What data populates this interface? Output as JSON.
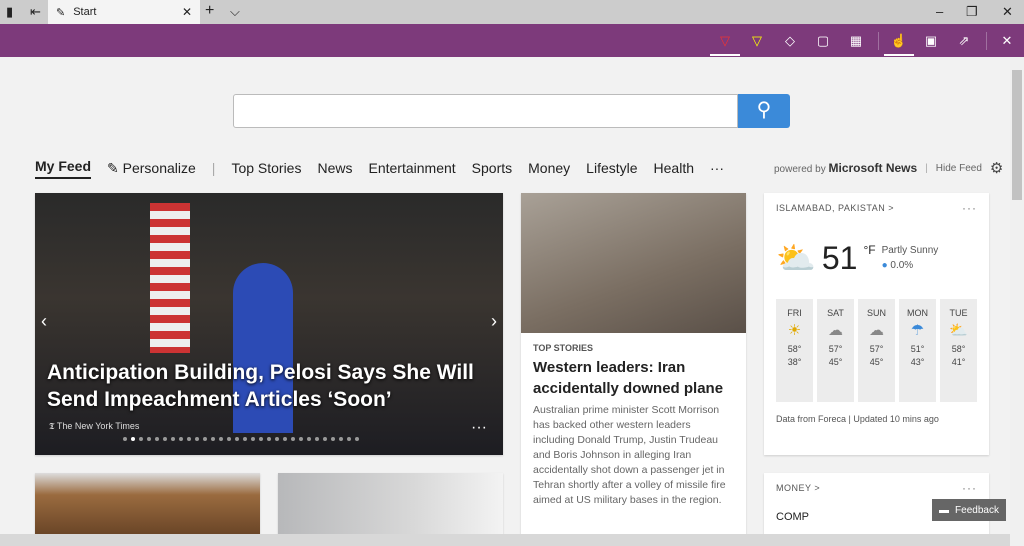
{
  "browser": {
    "tab_title": "Start",
    "new_tab": "+",
    "tab_list": "⌵",
    "minimize": "–",
    "restore": "❐",
    "close": "✕",
    "tab_close": "✕"
  },
  "ink_toolbar": {
    "icons": [
      "ballpoint-pen-icon",
      "highlighter-icon",
      "eraser-icon",
      "add-note-icon",
      "clip-icon",
      "touch-writing-icon",
      "save-icon",
      "share-icon",
      "close-icon"
    ],
    "accent": "#7d3a7b"
  },
  "search": {
    "placeholder": "",
    "button": "⚲"
  },
  "nav": {
    "items": [
      "My Feed",
      "Personalize",
      "Top Stories",
      "News",
      "Entertainment",
      "Sports",
      "Money",
      "Lifestyle",
      "Health",
      "···"
    ],
    "powered_by": "powered by",
    "brand": "Microsoft News",
    "hide_feed": "Hide Feed"
  },
  "hero": {
    "title": "Anticipation Building, Pelosi Says She Will Send Impeachment Articles ‘Soon’",
    "source": "The New York Times",
    "more": "···",
    "slides": 30,
    "active_slide": 1
  },
  "story": {
    "category": "TOP STORIES",
    "headline": "Western leaders: Iran accidentally downed plane",
    "body": "Australian prime minister Scott Morrison has backed other western leaders including Donald Trump, Justin Trudeau and Boris Johnson in alleging Iran accidentally shot down a passenger jet in Tehran shortly after a volley of missile fire aimed at US military bases in the region."
  },
  "weather": {
    "location": "ISLAMABAD, PAKISTAN",
    "chevron": ">",
    "more": "···",
    "temp": "51",
    "unit": "°F",
    "condition": "Partly Sunny",
    "precip": "0.0%",
    "forecast": [
      {
        "day": "FRI",
        "icon": "☀",
        "high": "58°",
        "low": "38°"
      },
      {
        "day": "SAT",
        "icon": "☁",
        "high": "57°",
        "low": "45°"
      },
      {
        "day": "SUN",
        "icon": "☁",
        "high": "57°",
        "low": "45°"
      },
      {
        "day": "MON",
        "icon": "☂",
        "high": "51°",
        "low": "43°"
      },
      {
        "day": "TUE",
        "icon": "⛅",
        "high": "58°",
        "low": "41°"
      }
    ],
    "footer": "Data from Foreca | Updated 10 mins ago"
  },
  "money": {
    "title": "MONEY",
    "chevron": ">",
    "more": "···",
    "first_item": "COMP"
  },
  "feedback": "Feedback"
}
